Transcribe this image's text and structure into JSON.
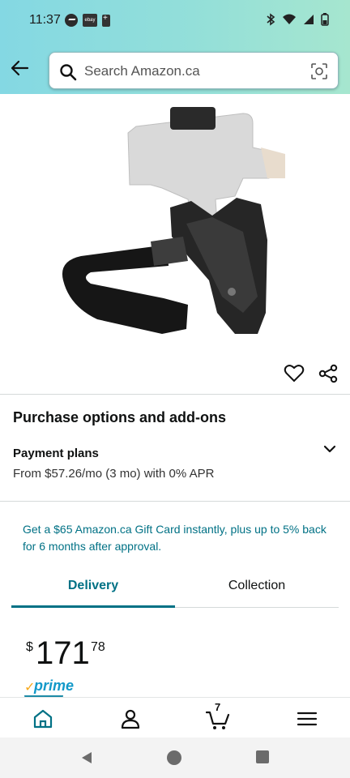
{
  "statusbar": {
    "time": "11:37",
    "left_icons": [
      "messenger-icon",
      "ebay-icon",
      "battery-saver-icon"
    ],
    "right_icons": [
      "bluetooth-icon",
      "wifi-icon",
      "signal-icon",
      "battery-icon"
    ],
    "ebay_label": "ebay"
  },
  "search": {
    "placeholder": "Search Amazon.ca"
  },
  "product": {
    "image_alt": "holster-product-image"
  },
  "purchase": {
    "title": "Purchase options and add-ons",
    "payment_title": "Payment plans",
    "payment_sub": "From $57.26/mo (3 mo) with 0% APR"
  },
  "promo": {
    "text": "Get a $65 Amazon.ca Gift Card instantly, plus up to 5% back for 6 months after approval."
  },
  "tabs": [
    {
      "label": "Delivery",
      "active": true
    },
    {
      "label": "Collection",
      "active": false
    }
  ],
  "price": {
    "symbol": "$",
    "whole": "171",
    "fraction": "78"
  },
  "prime": {
    "label": "prime",
    "check": "✓"
  },
  "bottom_nav": {
    "cart_count": "7",
    "items": [
      "home-icon",
      "account-icon",
      "cart-icon",
      "menu-icon"
    ]
  },
  "colors": {
    "accent": "#007185",
    "header_start": "#84d8e3",
    "header_end": "#a6e6cf",
    "prime_blue": "#1399c9",
    "prime_orange": "#f7a81b"
  }
}
